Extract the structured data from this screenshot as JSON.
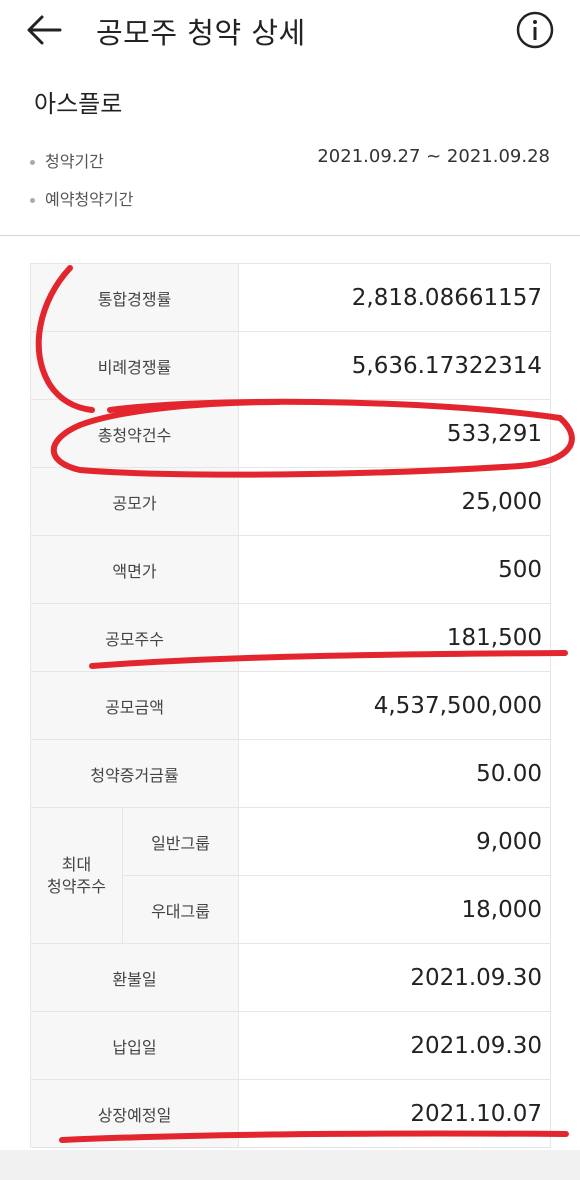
{
  "header": {
    "title": "공모주 청약 상세",
    "back_icon": "arrow-left-icon",
    "info_icon": "info-circle-icon"
  },
  "company": {
    "name": "아스플로"
  },
  "periods": [
    {
      "label": "청약기간",
      "value": "2021.09.27 ~ 2021.09.28"
    },
    {
      "label": "예약청약기간",
      "value": ""
    }
  ],
  "details": {
    "rows": [
      {
        "label": "통합경쟁률",
        "value": "2,818.08661157"
      },
      {
        "label": "비례경쟁률",
        "value": "5,636.17322314"
      },
      {
        "label": "총청약건수",
        "value": "533,291"
      },
      {
        "label": "공모가",
        "value": "25,000"
      },
      {
        "label": "액면가",
        "value": "500"
      },
      {
        "label": "공모주수",
        "value": "181,500"
      },
      {
        "label": "공모금액",
        "value": "4,537,500,000"
      },
      {
        "label": "청약증거금률",
        "value": "50.00"
      }
    ],
    "max_shares": {
      "label": "최대\n청약주수",
      "general_label": "일반그룹",
      "general_value": "9,000",
      "preferred_label": "우대그룹",
      "preferred_value": "18,000"
    },
    "dates": [
      {
        "label": "환불일",
        "value": "2021.09.30"
      },
      {
        "label": "납입일",
        "value": "2021.09.30"
      },
      {
        "label": "상장예정일",
        "value": "2021.10.07"
      }
    ]
  },
  "colors": {
    "annotation": "#e3262d",
    "label_bg": "#f7f7f7",
    "border": "#e6e6e6"
  }
}
